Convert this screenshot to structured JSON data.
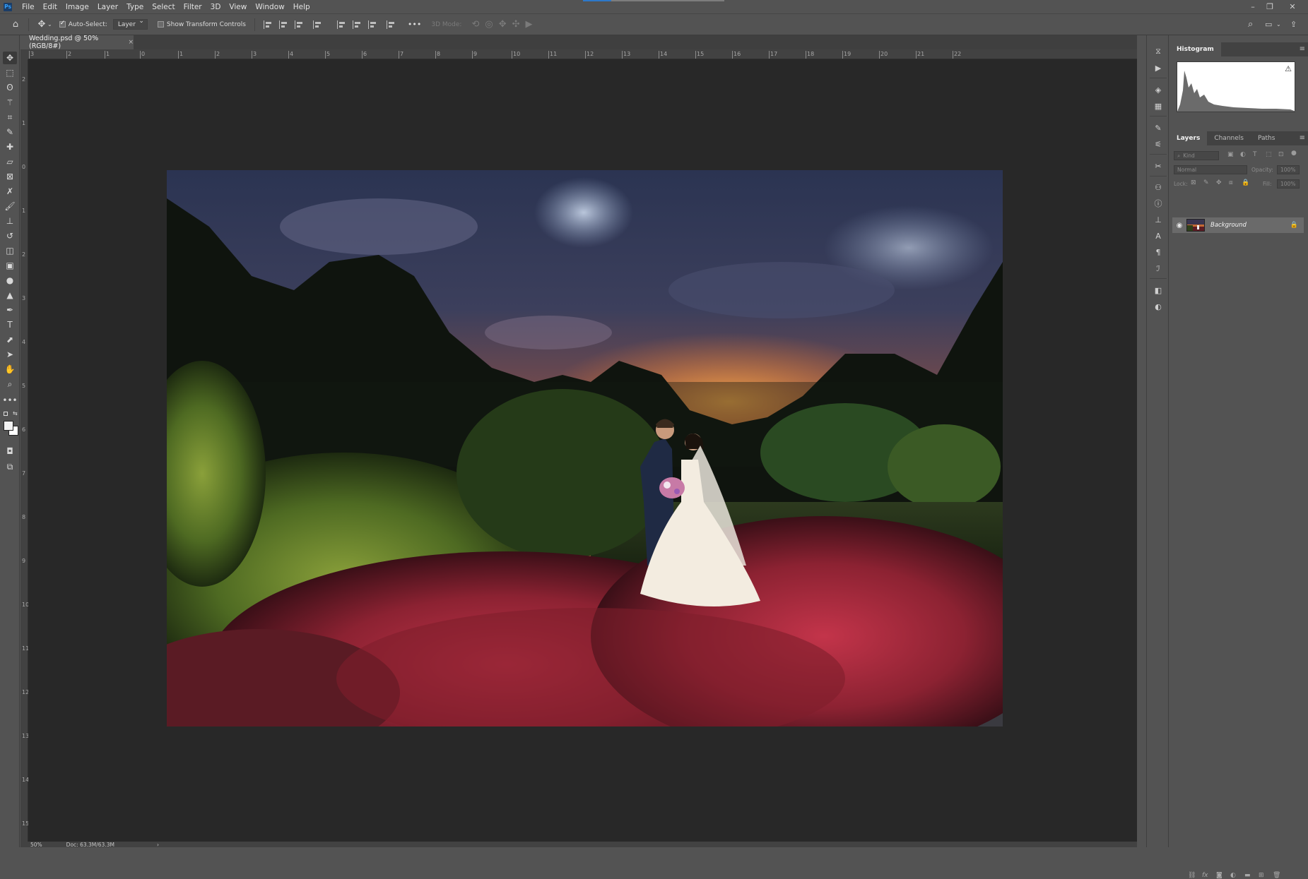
{
  "menubar": {
    "app_icon": "Ps",
    "items": [
      "File",
      "Edit",
      "Image",
      "Layer",
      "Type",
      "Select",
      "Filter",
      "3D",
      "View",
      "Window",
      "Help"
    ],
    "window_controls": {
      "minimize": "–",
      "restore": "❐",
      "close": "✕"
    }
  },
  "options": {
    "auto_select_label": "Auto-Select:",
    "auto_select_checked": true,
    "target_value": "Layer",
    "show_transform_label": "Show Transform Controls",
    "show_transform_checked": false,
    "more_label": "•••",
    "mode_3d_label": "3D Mode:"
  },
  "document": {
    "tab_title": "Wedding.psd @ 50% (RGB/8#)",
    "close_glyph": "×"
  },
  "ruler": {
    "h_ticks": [
      "3",
      "2",
      "1",
      "0",
      "1",
      "2",
      "3",
      "4",
      "5",
      "6",
      "7",
      "8",
      "9",
      "10",
      "11",
      "12",
      "13",
      "14",
      "15",
      "16",
      "17",
      "18",
      "19",
      "20",
      "21",
      "22"
    ],
    "v_ticks": [
      "2",
      "1",
      "0",
      "1",
      "2",
      "3",
      "4",
      "5",
      "6",
      "7",
      "8",
      "9",
      "10",
      "11",
      "12",
      "13",
      "14",
      "15"
    ]
  },
  "status": {
    "zoom": "50%",
    "doc_info": "Doc: 63.3M/63.3M",
    "arrow": "›"
  },
  "histogram_panel": {
    "tab": "Histogram",
    "warning_icon": "warning-icon"
  },
  "layers_panel": {
    "tabs": [
      "Layers",
      "Channels",
      "Paths"
    ],
    "filter_placeholder": "Kind",
    "blend_mode": "Normal",
    "opacity_label": "Opacity:",
    "opacity_value": "100%",
    "lock_label": "Lock:",
    "fill_label": "Fill:",
    "fill_value": "100%",
    "layers": [
      {
        "name": "Background",
        "visible": true,
        "locked": true
      }
    ]
  },
  "colors": {
    "chrome": "#535353",
    "canvas_bg": "#282828",
    "accent": "#2d78c9"
  }
}
